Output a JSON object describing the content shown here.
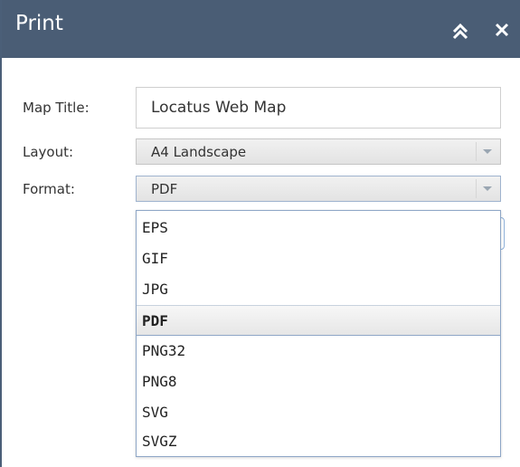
{
  "panel": {
    "title": "Print",
    "collapse_icon": "double-chevron-up-icon",
    "close_icon": "close-icon"
  },
  "form": {
    "map_title_label": "Map Title:",
    "map_title_value": "Locatus Web Map",
    "layout_label": "Layout:",
    "layout_value": "A4 Landscape",
    "format_label": "Format:",
    "format_value": "PDF"
  },
  "format_dropdown": {
    "options": [
      "EPS",
      "GIF",
      "JPG",
      "PDF",
      "PNG32",
      "PNG8",
      "SVG",
      "SVGZ"
    ],
    "selected": "PDF"
  },
  "colors": {
    "titlebar": "#4a5d75",
    "dropdown_border": "#8ea6c6"
  }
}
